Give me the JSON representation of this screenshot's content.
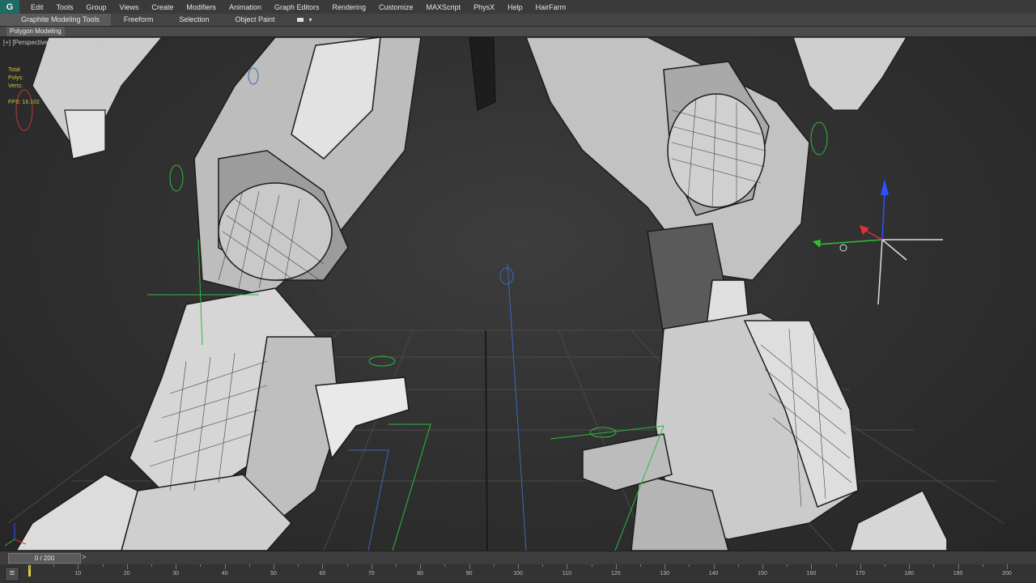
{
  "menu": {
    "logo": "G",
    "items": [
      "Edit",
      "Tools",
      "Group",
      "Views",
      "Create",
      "Modifiers",
      "Animation",
      "Graph Editors",
      "Rendering",
      "Customize",
      "MAXScript",
      "PhysX",
      "Help",
      "HairFarm"
    ]
  },
  "ribbon": {
    "tabs": [
      "Graphite Modeling Tools",
      "Freeform",
      "Selection",
      "Object Paint"
    ],
    "active_tab": "Graphite Modeling Tools",
    "panel_label": "Polygon Modeling"
  },
  "viewport": {
    "label": "[+] [Perspective] [Realistic + Edged Faces]",
    "stats": {
      "title": "Total",
      "polys_label": "Polys:",
      "verts_label": "Verts:",
      "fps_label": "FPS:",
      "fps_value": "16.102"
    }
  },
  "timeline": {
    "frame_display": "0 / 200",
    "next_glyph": ">",
    "ticks": [
      10,
      20,
      30,
      40,
      50,
      60,
      70,
      80,
      90,
      100,
      110,
      120,
      130,
      140,
      150,
      160,
      170,
      180,
      190,
      200
    ],
    "range": [
      0,
      200
    ]
  },
  "colors": {
    "menubar": "#3a3a3a",
    "viewport_bg": "#2f2f2f",
    "accent_logo": "#1e6b66",
    "stats_text": "#d2c04a",
    "gizmo_x": "#e03030",
    "gizmo_y": "#30c030",
    "gizmo_z": "#3050ff"
  },
  "icons": {
    "app_logo": "app-logo-icon",
    "ribbon_toggle": "panel-toggle-icon",
    "trackbar_toggle": "trackbar-toggle-icon",
    "gizmo": "transform-gizmo-icon"
  }
}
